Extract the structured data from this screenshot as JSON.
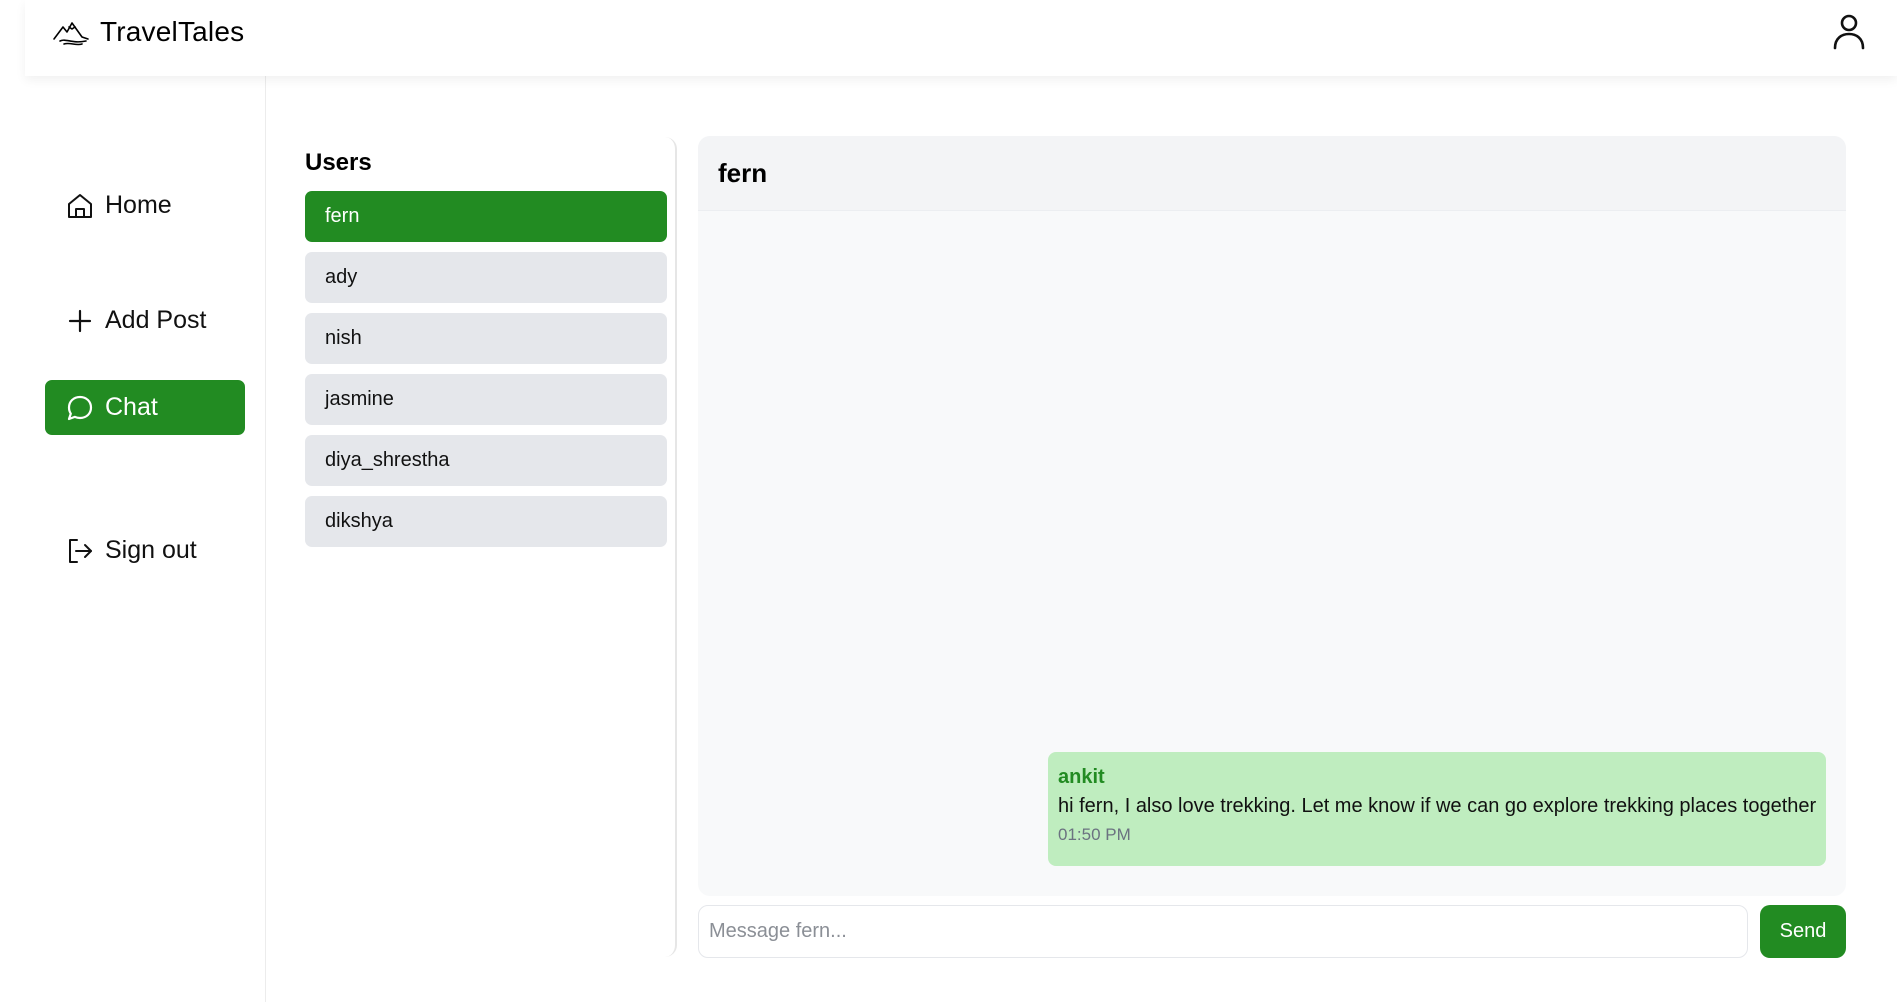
{
  "brand": {
    "name": "TravelTales",
    "logo_icon": "mountain-icon"
  },
  "header": {
    "profile_icon": "user-icon"
  },
  "sidebar": {
    "items": [
      {
        "label": "Home",
        "icon": "home-icon",
        "active": false
      },
      {
        "label": "Add Post",
        "icon": "plus-icon",
        "active": false
      },
      {
        "label": "Chat",
        "icon": "chat-bubble-icon",
        "active": true
      },
      {
        "label": "Sign out",
        "icon": "sign-out-icon",
        "active": false
      }
    ]
  },
  "users": {
    "title": "Users",
    "list": [
      "fern",
      "ady",
      "nish",
      "jasmine",
      "diya_shrestha",
      "dikshya"
    ],
    "selected": "fern"
  },
  "chat": {
    "recipient": "fern",
    "messages": [
      {
        "sender": "ankit",
        "text": "hi fern, I also love trekking. Let me know if we can go explore trekking places together",
        "time": "01:50 PM"
      }
    ],
    "input_placeholder": "Message fern...",
    "input_value": "",
    "send_label": "Send"
  },
  "colors": {
    "accent": "#228b22",
    "message_bubble": "#bfedbf",
    "inactive_item": "#e5e7eb",
    "chat_background": "#f8f9fa"
  }
}
